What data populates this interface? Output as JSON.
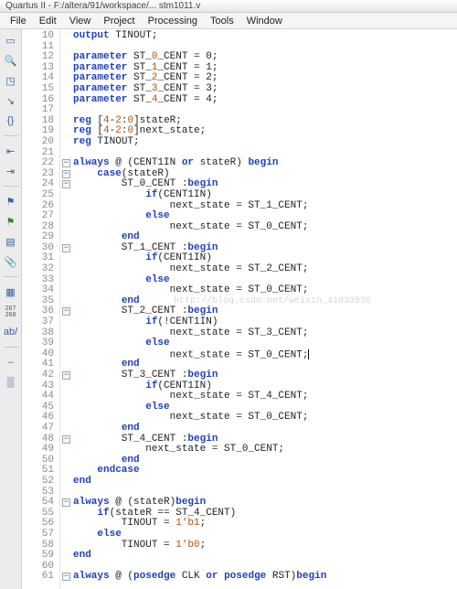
{
  "title": "Quartus II - F:/altera/91/workspace/...  stm1011.v",
  "menu": [
    "File",
    "Edit",
    "View",
    "Project",
    "Processing",
    "Tools",
    "Window"
  ],
  "side_icons": [
    {
      "name": "new-file-icon",
      "glyph": "▭"
    },
    {
      "name": "find-icon",
      "glyph": "🔍"
    },
    {
      "name": "bookmark-icon",
      "glyph": "◳"
    },
    {
      "name": "step-icon",
      "glyph": "↘"
    },
    {
      "name": "braces-icon",
      "glyph": "{}"
    },
    {
      "name": "sep",
      "glyph": ""
    },
    {
      "name": "indent-left-icon",
      "glyph": "⇤"
    },
    {
      "name": "indent-right-icon",
      "glyph": "⇥"
    },
    {
      "name": "sep",
      "glyph": ""
    },
    {
      "name": "flag-blue-icon",
      "glyph": "⚑"
    },
    {
      "name": "flag-green-icon",
      "glyph": "⚑"
    },
    {
      "name": "doc-icon",
      "glyph": "▤"
    },
    {
      "name": "attach-icon",
      "glyph": "📎"
    },
    {
      "name": "sep",
      "glyph": ""
    },
    {
      "name": "syntax-icon",
      "glyph": "▦"
    },
    {
      "name": "linecol-icon",
      "glyph": "267\n268"
    },
    {
      "name": "ab-icon",
      "glyph": "ab/"
    },
    {
      "name": "sep",
      "glyph": ""
    },
    {
      "name": "ruler-icon",
      "glyph": "┄"
    },
    {
      "name": "grid-icon",
      "glyph": "▒"
    }
  ],
  "first_line": 10,
  "foldable_lines": [
    22,
    23,
    24,
    30,
    36,
    42,
    48,
    54,
    61
  ],
  "watermark": "http://blog.csdn.net/weixin_41033536",
  "watermark_line": 35,
  "caret_line": 40,
  "lines": [
    {
      "n": 10,
      "t": "output TINOUT;",
      "kw": [
        "output"
      ]
    },
    {
      "n": 11,
      "t": ""
    },
    {
      "n": 12,
      "t": "parameter ST_0_CENT = 0;",
      "kw": [
        "parameter"
      ],
      "nums": [
        "0"
      ]
    },
    {
      "n": 13,
      "t": "parameter ST_1_CENT = 1;",
      "kw": [
        "parameter"
      ],
      "nums": [
        "1"
      ]
    },
    {
      "n": 14,
      "t": "parameter ST_2_CENT = 2;",
      "kw": [
        "parameter"
      ],
      "nums": [
        "2"
      ]
    },
    {
      "n": 15,
      "t": "parameter ST_3_CENT = 3;",
      "kw": [
        "parameter"
      ],
      "nums": [
        "3"
      ]
    },
    {
      "n": 16,
      "t": "parameter ST_4_CENT = 4;",
      "kw": [
        "parameter"
      ],
      "nums": [
        "4"
      ]
    },
    {
      "n": 17,
      "t": ""
    },
    {
      "n": 18,
      "t": "reg [4-2:0]stateR;",
      "kw": [
        "reg"
      ],
      "nums": [
        "4",
        "2",
        "0"
      ]
    },
    {
      "n": 19,
      "t": "reg [4-2:0]next_state;",
      "kw": [
        "reg"
      ],
      "nums": [
        "4",
        "2",
        "0"
      ]
    },
    {
      "n": 20,
      "t": "reg TINOUT;",
      "kw": [
        "reg"
      ]
    },
    {
      "n": 21,
      "t": ""
    },
    {
      "n": 22,
      "t": "always @ (CENT1IN or stateR) begin",
      "kw": [
        "always",
        "or",
        "begin"
      ]
    },
    {
      "n": 23,
      "t": "    case(stateR)",
      "kw": [
        "case"
      ]
    },
    {
      "n": 24,
      "t": "        ST_0_CENT :begin",
      "kw": [
        "begin"
      ]
    },
    {
      "n": 25,
      "t": "            if(CENT1IN)",
      "kw": [
        "if"
      ]
    },
    {
      "n": 26,
      "t": "                next_state = ST_1_CENT;"
    },
    {
      "n": 27,
      "t": "            else",
      "kw": [
        "else"
      ]
    },
    {
      "n": 28,
      "t": "                next_state = ST_0_CENT;"
    },
    {
      "n": 29,
      "t": "        end",
      "kw": [
        "end"
      ]
    },
    {
      "n": 30,
      "t": "        ST_1_CENT :begin",
      "kw": [
        "begin"
      ]
    },
    {
      "n": 31,
      "t": "            if(CENT1IN)",
      "kw": [
        "if"
      ]
    },
    {
      "n": 32,
      "t": "                next_state = ST_2_CENT;"
    },
    {
      "n": 33,
      "t": "            else",
      "kw": [
        "else"
      ]
    },
    {
      "n": 34,
      "t": "                next_state = ST_0_CENT;"
    },
    {
      "n": 35,
      "t": "        end",
      "kw": [
        "end"
      ]
    },
    {
      "n": 36,
      "t": "        ST_2_CENT :begin",
      "kw": [
        "begin"
      ]
    },
    {
      "n": 37,
      "t": "            if(!CENT1IN)",
      "kw": [
        "if"
      ]
    },
    {
      "n": 38,
      "t": "                next_state = ST_3_CENT;"
    },
    {
      "n": 39,
      "t": "            else",
      "kw": [
        "else"
      ]
    },
    {
      "n": 40,
      "t": "                next_state = ST_0_CENT;"
    },
    {
      "n": 41,
      "t": "        end",
      "kw": [
        "end"
      ]
    },
    {
      "n": 42,
      "t": "        ST_3_CENT :begin",
      "kw": [
        "begin"
      ]
    },
    {
      "n": 43,
      "t": "            if(CENT1IN)",
      "kw": [
        "if"
      ]
    },
    {
      "n": 44,
      "t": "                next_state = ST_4_CENT;"
    },
    {
      "n": 45,
      "t": "            else",
      "kw": [
        "else"
      ]
    },
    {
      "n": 46,
      "t": "                next_state = ST_0_CENT;"
    },
    {
      "n": 47,
      "t": "        end",
      "kw": [
        "end"
      ]
    },
    {
      "n": 48,
      "t": "        ST_4_CENT :begin",
      "kw": [
        "begin"
      ]
    },
    {
      "n": 49,
      "t": "            next_state = ST_0_CENT;"
    },
    {
      "n": 50,
      "t": "        end",
      "kw": [
        "end"
      ]
    },
    {
      "n": 51,
      "t": "    endcase",
      "kw": [
        "endcase"
      ]
    },
    {
      "n": 52,
      "t": "end",
      "kw": [
        "end"
      ]
    },
    {
      "n": 53,
      "t": ""
    },
    {
      "n": 54,
      "t": "always @ (stateR)begin",
      "kw": [
        "always",
        "begin"
      ]
    },
    {
      "n": 55,
      "t": "    if(stateR == ST_4_CENT)",
      "kw": [
        "if"
      ]
    },
    {
      "n": 56,
      "t": "        TINOUT = 1'b1;",
      "nums": [
        "1'b1"
      ]
    },
    {
      "n": 57,
      "t": "    else",
      "kw": [
        "else"
      ]
    },
    {
      "n": 58,
      "t": "        TINOUT = 1'b0;",
      "nums": [
        "1'b0"
      ]
    },
    {
      "n": 59,
      "t": "end",
      "kw": [
        "end"
      ]
    },
    {
      "n": 60,
      "t": ""
    },
    {
      "n": 61,
      "t": "always @ (posedge CLK or posedge RST)begin",
      "kw": [
        "always",
        "posedge",
        "or",
        "begin"
      ]
    }
  ]
}
